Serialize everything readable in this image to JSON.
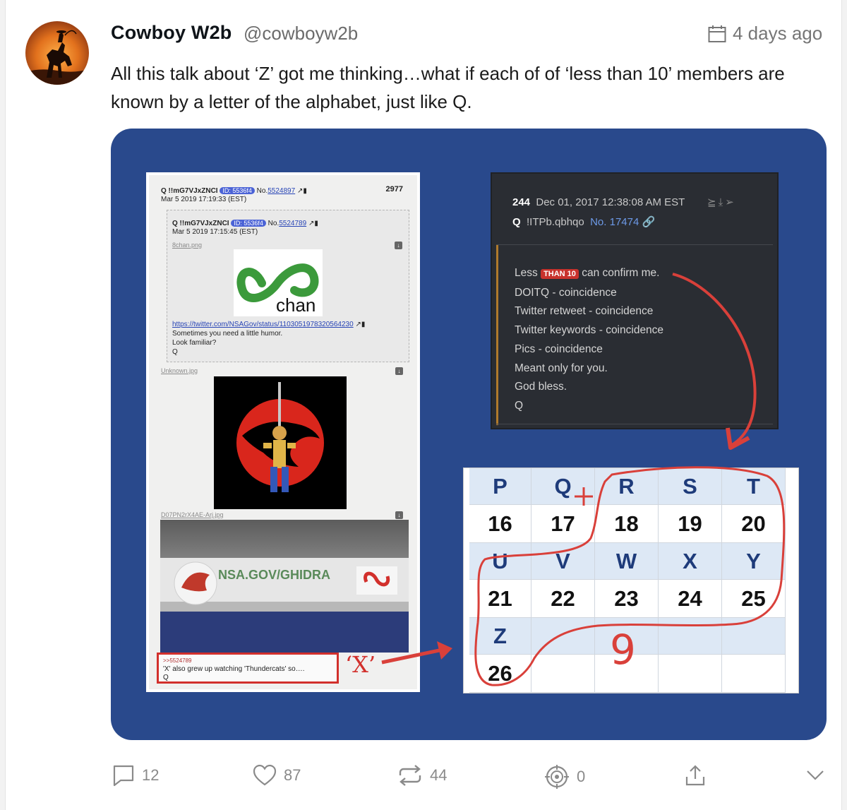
{
  "post": {
    "author_name": "Cowboy W2b",
    "author_handle": "@cowboyw2b",
    "timestamp": "4 days ago",
    "text": "All this talk about ‘Z’ got me thinking…what if each of of ‘less than 10’ members are known by a letter of the alphabet, just like Q."
  },
  "image": {
    "left_post": {
      "header_line1": "Q !!mG7VJxZNCI",
      "id_badge": "ID: 5536f4",
      "post_no_prefix": "No.",
      "post_no": "5524897",
      "header_line2": "Mar 5 2019 17:19:33 (EST)",
      "count": "2977",
      "quoted_header_line1": "Q !!mG7VJxZNCI",
      "quoted_id_badge": "ID: 5536f4",
      "quoted_no_prefix": "No.",
      "quoted_no": "5524789",
      "quoted_header_line2": "Mar 5 2019 17:15:45 (EST)",
      "file1": "8chan.png",
      "logo_text": "chan",
      "tweet_link": "https://twitter.com/NSAGov/status/1103051978320564230",
      "line1": "Sometimes you need a little humor.",
      "line2": "Look familiar?",
      "line3": "Q",
      "file2": "Unknown.jpg",
      "file3": "D07PN2rX4AE-Arj.jpg",
      "ghidra_text": "NSA.GOV/GHIDRA",
      "reply_ref": ">>5524789",
      "reply_text": "'X' also grew up watching 'Thundercats' so….",
      "reply_sig": "Q",
      "annotation_x": "‘X’"
    },
    "q_drop": {
      "number": "244",
      "date": "Dec 01, 2017 12:38:08 AM EST",
      "author": "Q",
      "tripcode": "!ITPb.qbhqo",
      "post_no": "No. 17474",
      "line_less": "Less",
      "badge": "THAN 10",
      "line_less_rest": "can confirm me.",
      "lines": [
        "DOITQ - coincidence",
        "Twitter retweet - coincidence",
        "Twitter keywords - coincidence",
        "Pics - coincidence",
        "Meant only for you.",
        "God bless.",
        "Q"
      ]
    },
    "letter_table": {
      "rows": [
        [
          "P",
          "Q",
          "R",
          "S",
          "T"
        ],
        [
          "16",
          "17",
          "18",
          "19",
          "20"
        ],
        [
          "U",
          "V",
          "W",
          "X",
          "Y"
        ],
        [
          "21",
          "22",
          "23",
          "24",
          "25"
        ],
        [
          "Z",
          "",
          "",
          "",
          ""
        ],
        [
          "26",
          "",
          "",
          "",
          ""
        ]
      ],
      "annotation_plus": "+",
      "annotation_nine": "9"
    }
  },
  "actions": {
    "replies": "12",
    "likes": "87",
    "reposts": "44",
    "target_count": "0"
  },
  "colors": {
    "media_bg": "#29498c",
    "annotation_red": "#d2302c",
    "table_letter_bg": "#dde8f5"
  }
}
